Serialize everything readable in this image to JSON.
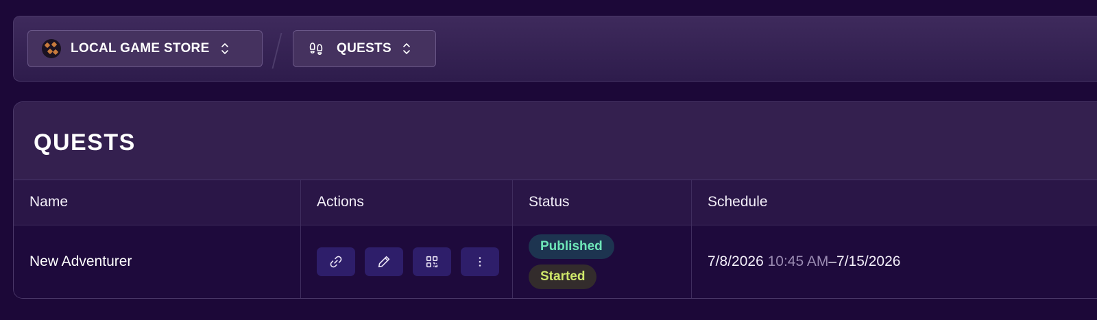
{
  "breadcrumb": {
    "store_label": "LOCAL GAME STORE",
    "section_label": "QUESTS"
  },
  "panel": {
    "title": "QUESTS"
  },
  "table": {
    "columns": [
      "Name",
      "Actions",
      "Status",
      "Schedule"
    ],
    "rows": [
      {
        "name": "New Adventurer",
        "actions": [
          "link-icon",
          "pencil-icon",
          "qr-code-icon",
          "more-vertical-icon"
        ],
        "status": [
          "Published",
          "Started"
        ],
        "schedule": {
          "start_date": "7/8/2026",
          "start_time": "10:45 AM",
          "separator": "–",
          "end_date": "7/15/2026"
        }
      }
    ]
  },
  "colors": {
    "background": "#1c0838",
    "published_text": "#6ee6b8",
    "started_text": "#cfe86a",
    "action_button": "#2e1e6a"
  }
}
